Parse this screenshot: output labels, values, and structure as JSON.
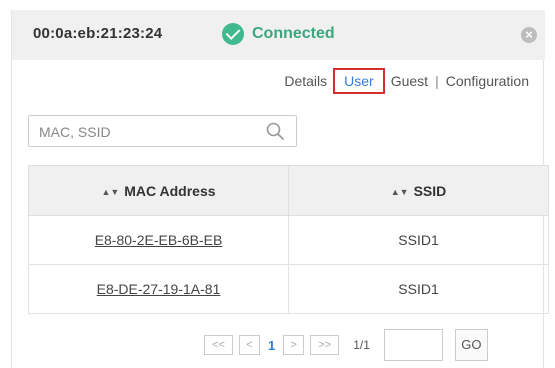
{
  "header": {
    "mac": "00:0a:eb:21:23:24",
    "status": "Connected",
    "close_symbol": "×"
  },
  "tabs": [
    {
      "label": "Details",
      "active": false
    },
    {
      "label": "User",
      "active": true
    },
    {
      "label": "Guest",
      "active": false
    },
    {
      "label": "Configuration",
      "active": false
    }
  ],
  "tab_separator": "|",
  "search": {
    "placeholder": "MAC, SSID",
    "value": ""
  },
  "table": {
    "sort_icon": "▲▼",
    "columns": [
      "MAC Address",
      "SSID"
    ],
    "rows": [
      {
        "mac": "E8-80-2E-EB-6B-EB",
        "ssid": "SSID1"
      },
      {
        "mac": "E8-DE-27-19-1A-81",
        "ssid": "SSID1"
      }
    ]
  },
  "pagination": {
    "first": "<<",
    "prev": "<",
    "current": "1",
    "next": ">",
    "last": ">>",
    "total": "1/1",
    "goto_value": "",
    "go_label": "GO"
  },
  "colors": {
    "connected": "#3fb98d",
    "active_tab": "#2e7cd6",
    "highlight_border": "#d32f2f"
  },
  "icons": {
    "status": "check-circle-icon",
    "close": "close-icon",
    "search": "search-icon",
    "sort": "sort-icon"
  }
}
